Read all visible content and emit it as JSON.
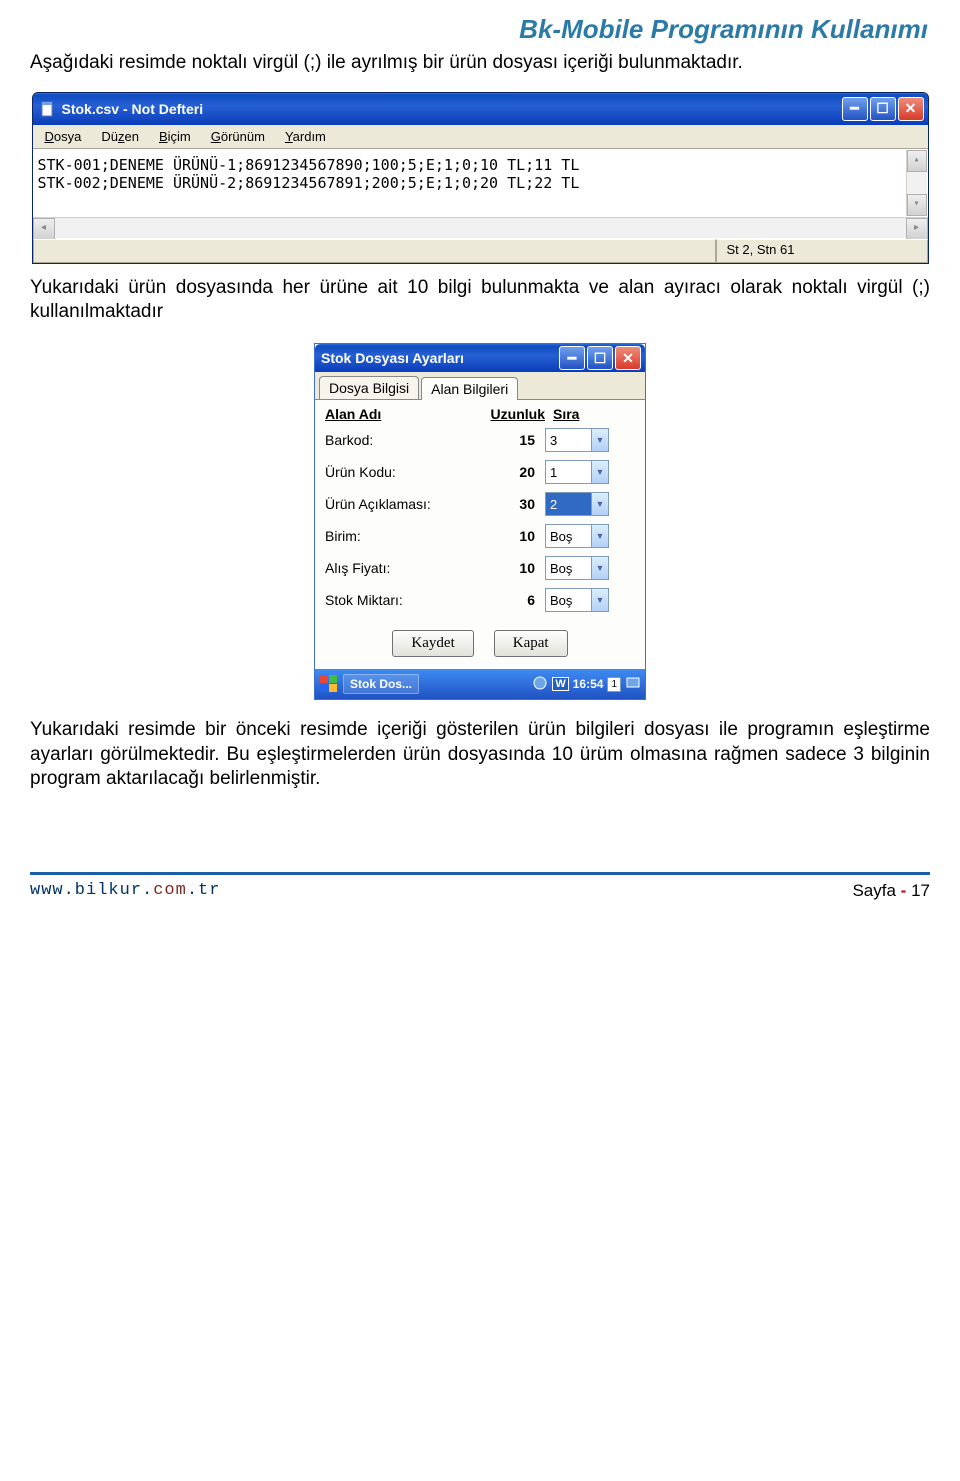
{
  "header_title": "Bk-Mobile Programının Kullanımı",
  "para1": "Aşağıdaki resimde noktalı virgül (;) ile ayrılmış bir ürün dosyası içeriği bulunmaktadır.",
  "notepad": {
    "title": "Stok.csv - Not Defteri",
    "menus": [
      "Dosya",
      "Düzen",
      "Biçim",
      "Görünüm",
      "Yardım"
    ],
    "lines": [
      "STK-001;DENEME ÜRÜNÜ-1;8691234567890;100;5;E;1;0;10 TL;11 TL",
      "STK-002;DENEME ÜRÜNÜ-2;8691234567891;200;5;E;1;0;20 TL;22 TL"
    ],
    "status": "St 2, Stn 61"
  },
  "para2": "Yukarıdaki ürün dosyasında her ürüne ait 10 bilgi bulunmakta ve alan ayıracı olarak noktalı virgül (;) kullanılmaktadır",
  "settings": {
    "title": "Stok Dosyası Ayarları",
    "tabs": [
      "Dosya Bilgisi",
      "Alan Bilgileri"
    ],
    "active_tab": 1,
    "headers": {
      "c1": "Alan Adı",
      "c2": "Uzunluk",
      "c3": "Sıra"
    },
    "rows": [
      {
        "label": "Barkod:",
        "len": "15",
        "sira": "3",
        "selected": false
      },
      {
        "label": "Ürün Kodu:",
        "len": "20",
        "sira": "1",
        "selected": false
      },
      {
        "label": "Ürün Açıklaması:",
        "len": "30",
        "sira": "2",
        "selected": true
      },
      {
        "label": "Birim:",
        "len": "10",
        "sira": "Boş",
        "selected": false
      },
      {
        "label": "Alış Fiyatı:",
        "len": "10",
        "sira": "Boş",
        "selected": false
      },
      {
        "label": "Stok Miktarı:",
        "len": "6",
        "sira": "Boş",
        "selected": false
      }
    ],
    "buttons": {
      "save": "Kaydet",
      "close": "Kapat"
    },
    "taskbar": {
      "task": "Stok Dos...",
      "time": "16:54",
      "indicator": "1"
    }
  },
  "para3": "Yukarıdaki resimde bir önceki resimde içeriği gösterilen ürün bilgileri dosyası ile programın eşleştirme ayarları görülmektedir. Bu eşleştirmelerden ürün dosyasında 10 ürüm olmasına rağmen sadece 3 bilginin program aktarılacağı belirlenmiştir.",
  "footer": {
    "url_parts": [
      "www.bilkur.",
      "com",
      ".tr"
    ],
    "page_label": "Sayfa",
    "page_sep": "-",
    "page_num": "17"
  }
}
